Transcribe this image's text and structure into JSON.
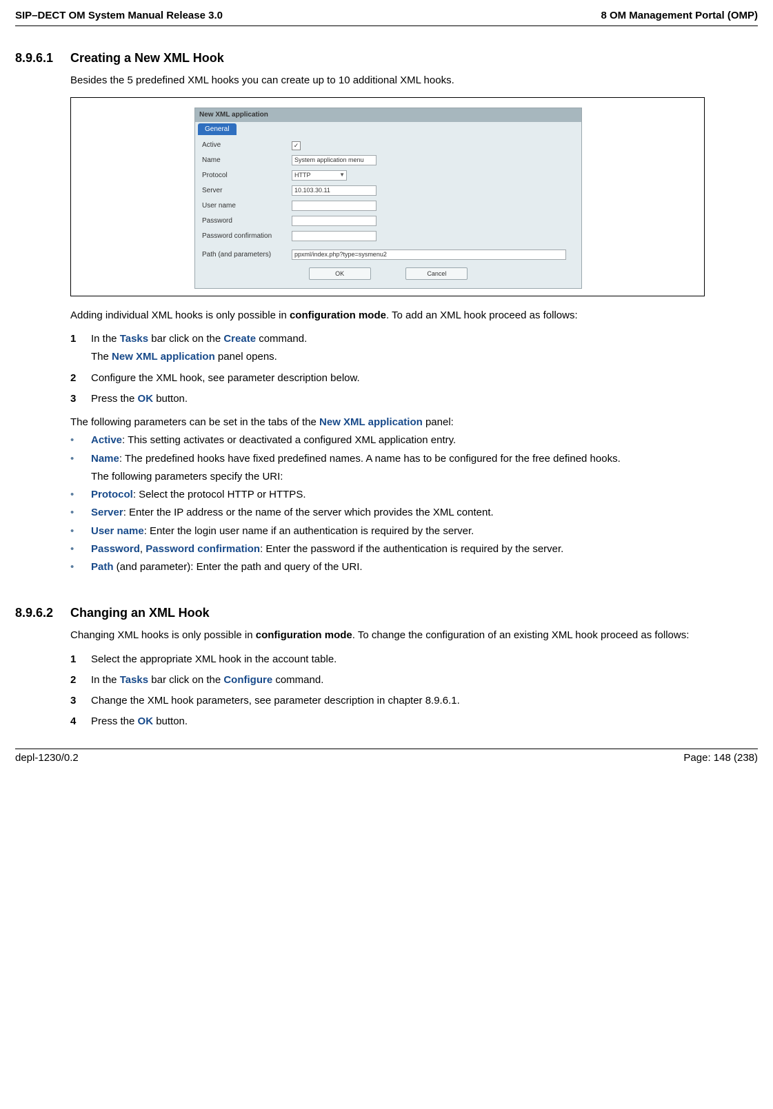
{
  "header": {
    "left": "SIP–DECT OM System Manual Release 3.0",
    "right": "8 OM Management Portal (OMP)"
  },
  "footer": {
    "left": "depl-1230/0.2",
    "right": "Page: 148 (238)"
  },
  "section1": {
    "num": "8.9.6.1",
    "title": "Creating a New XML Hook",
    "intro": "Besides the 5 predefined XML hooks you can create up to 10 additional XML hooks.",
    "after_fig_p1_a": "Adding individual XML hooks is only possible in ",
    "after_fig_p1_b": "configuration mode",
    "after_fig_p1_c": ". To add an XML hook proceed as follows:",
    "steps": [
      {
        "n": "1",
        "t1a": "In the ",
        "t1b": "Tasks",
        "t1c": " bar click on the ",
        "t1d": "Create",
        "t1e": " command.",
        "sub_a": "The ",
        "sub_b": "New XML application",
        "sub_c": " panel opens."
      },
      {
        "n": "2",
        "t": "Configure the XML hook, see parameter description below."
      },
      {
        "n": "3",
        "t1a": "Press the ",
        "t1b": "OK",
        "t1c": " button."
      }
    ],
    "params_intro_a": "The following parameters can be set in the tabs of the ",
    "params_intro_b": "New XML application",
    "params_intro_c": " panel:",
    "bullets": [
      {
        "label": "Active",
        "rest": ": This setting activates or deactivated a configured XML application entry."
      },
      {
        "label": "Name",
        "rest": ": The predefined hooks have fixed predefined names. A name has to be configured for the free defined hooks.",
        "sub": "The following parameters specify the URI:"
      },
      {
        "label": "Protocol",
        "rest": ": Select the protocol HTTP or HTTPS."
      },
      {
        "label": "Server",
        "rest": ": Enter the IP address or the name of the server which provides the XML content."
      },
      {
        "label": "User name",
        "rest": ": Enter the login user name if an authentication is required by the server."
      },
      {
        "label": "Password",
        "label2": "Password confirmation",
        "sep": ", ",
        "rest": ": Enter the password if the authentication is required by the server."
      },
      {
        "label": "Path",
        "rest_plain": " (and parameter): Enter the path and query of the URI."
      }
    ]
  },
  "dialog": {
    "title": "New XML application",
    "tab": "General",
    "rows": {
      "active": "Active",
      "name_label": "Name",
      "name_value": "System application menu",
      "protocol_label": "Protocol",
      "protocol_value": "HTTP",
      "server_label": "Server",
      "server_value": "10.103.30.11",
      "user_label": "User name",
      "pw_label": "Password",
      "pwc_label": "Password confirmation",
      "path_label": "Path (and parameters)",
      "path_value": "ppxml/index.php?type=sysmenu2"
    },
    "ok": "OK",
    "cancel": "Cancel"
  },
  "section2": {
    "num": "8.9.6.2",
    "title": "Changing an XML Hook",
    "intro_a": "Changing XML hooks is only possible in ",
    "intro_b": "configuration mode",
    "intro_c": ". To change the configuration of an existing XML hook proceed as follows:",
    "steps": [
      {
        "n": "1",
        "t": "Select the appropriate XML hook in the account table."
      },
      {
        "n": "2",
        "t1a": "In the ",
        "t1b": "Tasks",
        "t1c": " bar click on the ",
        "t1d": "Configure",
        "t1e": " command."
      },
      {
        "n": "3",
        "t": "Change the XML hook parameters, see parameter description in chapter 8.9.6.1."
      },
      {
        "n": "4",
        "t1a": "Press the ",
        "t1b": "OK",
        "t1c": " button."
      }
    ]
  }
}
